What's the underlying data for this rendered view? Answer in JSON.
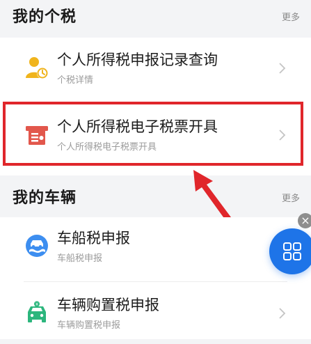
{
  "tax_section": {
    "title": "我的个税",
    "more_label": "更多",
    "items": [
      {
        "title": "个人所得税申报记录查询",
        "subtitle": "个税详情",
        "icon": "person-clock-icon"
      },
      {
        "title": "个人所得税电子税票开具",
        "subtitle": "个人所得税电子税票开具",
        "icon": "tax-receipt-icon"
      }
    ]
  },
  "vehicle_section": {
    "title": "我的车辆",
    "more_label": "更多",
    "items": [
      {
        "title": "车船税申报",
        "subtitle": "车船税申报",
        "icon": "car-ship-icon"
      },
      {
        "title": "车辆购置税申报",
        "subtitle": "车辆购置税申报",
        "icon": "car-purchase-icon"
      }
    ]
  },
  "floating_button": {
    "icon": "grid-icon",
    "close_icon": "close-icon"
  },
  "annotation": {
    "highlight_color": "#e0262b",
    "arrow_color": "#e0262b"
  },
  "colors": {
    "accent_blue": "#1e74e8",
    "icon_yellow": "#f0b41c",
    "icon_red": "#e2574c",
    "icon_green": "#2cb67d",
    "icon_blue": "#3d8ef0"
  }
}
